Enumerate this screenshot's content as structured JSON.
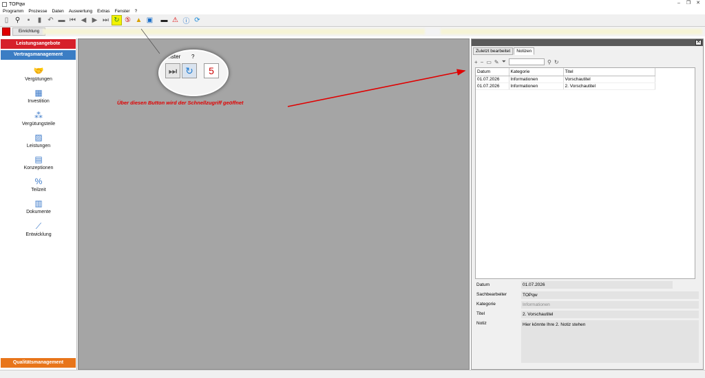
{
  "window": {
    "title": "TOPqw",
    "minimize": "–",
    "restore": "❐",
    "close": "✕"
  },
  "menu": [
    "Programm",
    "Prozesse",
    "Daten",
    "Auswertung",
    "Extras",
    "Fenster",
    "?"
  ],
  "toolbar2": {
    "einrichtung": "Einrichtung"
  },
  "sidebar": {
    "leistungsangebote": "Leistungsangebote",
    "vertragsmanagement": "Vertragsmanagement",
    "items": [
      {
        "label": "Vergütungen",
        "icon": "handshake-icon",
        "glyph": "🤝"
      },
      {
        "label": "Investition",
        "icon": "building-icon",
        "glyph": "▦"
      },
      {
        "label": "Vergütungsteile",
        "icon": "parts-icon",
        "glyph": "⁂"
      },
      {
        "label": "Leistungen",
        "icon": "chart-doc-icon",
        "glyph": "▨"
      },
      {
        "label": "Konzeptionen",
        "icon": "doc-icon",
        "glyph": "▤"
      },
      {
        "label": "Teilzeit",
        "icon": "percent-icon",
        "glyph": "%"
      },
      {
        "label": "Dokumente",
        "icon": "document-icon",
        "glyph": "▥"
      },
      {
        "label": "Entwicklung",
        "icon": "trend-icon",
        "glyph": "⟋"
      }
    ],
    "qualitaetsmanagement": "Qualitätsmanagement"
  },
  "zoom": {
    "fenster": "enster",
    "question": "?",
    "cal_day": "5"
  },
  "annotation": "Über diesen Button wird der Schnellzugriff geöffnet",
  "right_panel": {
    "close": "✕",
    "tabs": [
      "Zuletzt bearbeitet",
      "Notizen"
    ],
    "columns": [
      "Datum",
      "Kategorie",
      "Titel"
    ],
    "rows": [
      [
        "01.07.2026",
        "Informationen",
        "Vorschautitel"
      ],
      [
        "01.07.2026",
        "Informationen",
        "2. Vorschautitel"
      ]
    ],
    "form": {
      "datum_label": "Datum",
      "datum": "01.07.2026",
      "sachbearbeiter_label": "Sachbearbeiter",
      "sachbearbeiter": "TOPqw",
      "kategorie_label": "Kategorie",
      "kategorie": "Informationen",
      "titel_label": "Titel",
      "titel": "2. Vorschautitel",
      "notiz_label": "Notiz",
      "notiz": "Hier könnte Ihre 2. Notiz stehen"
    }
  },
  "colors": {
    "red": "#d6202a",
    "blue": "#3b7dc4",
    "orange": "#e8751a",
    "highlight": "#f2f200",
    "annotation": "#e00000"
  }
}
